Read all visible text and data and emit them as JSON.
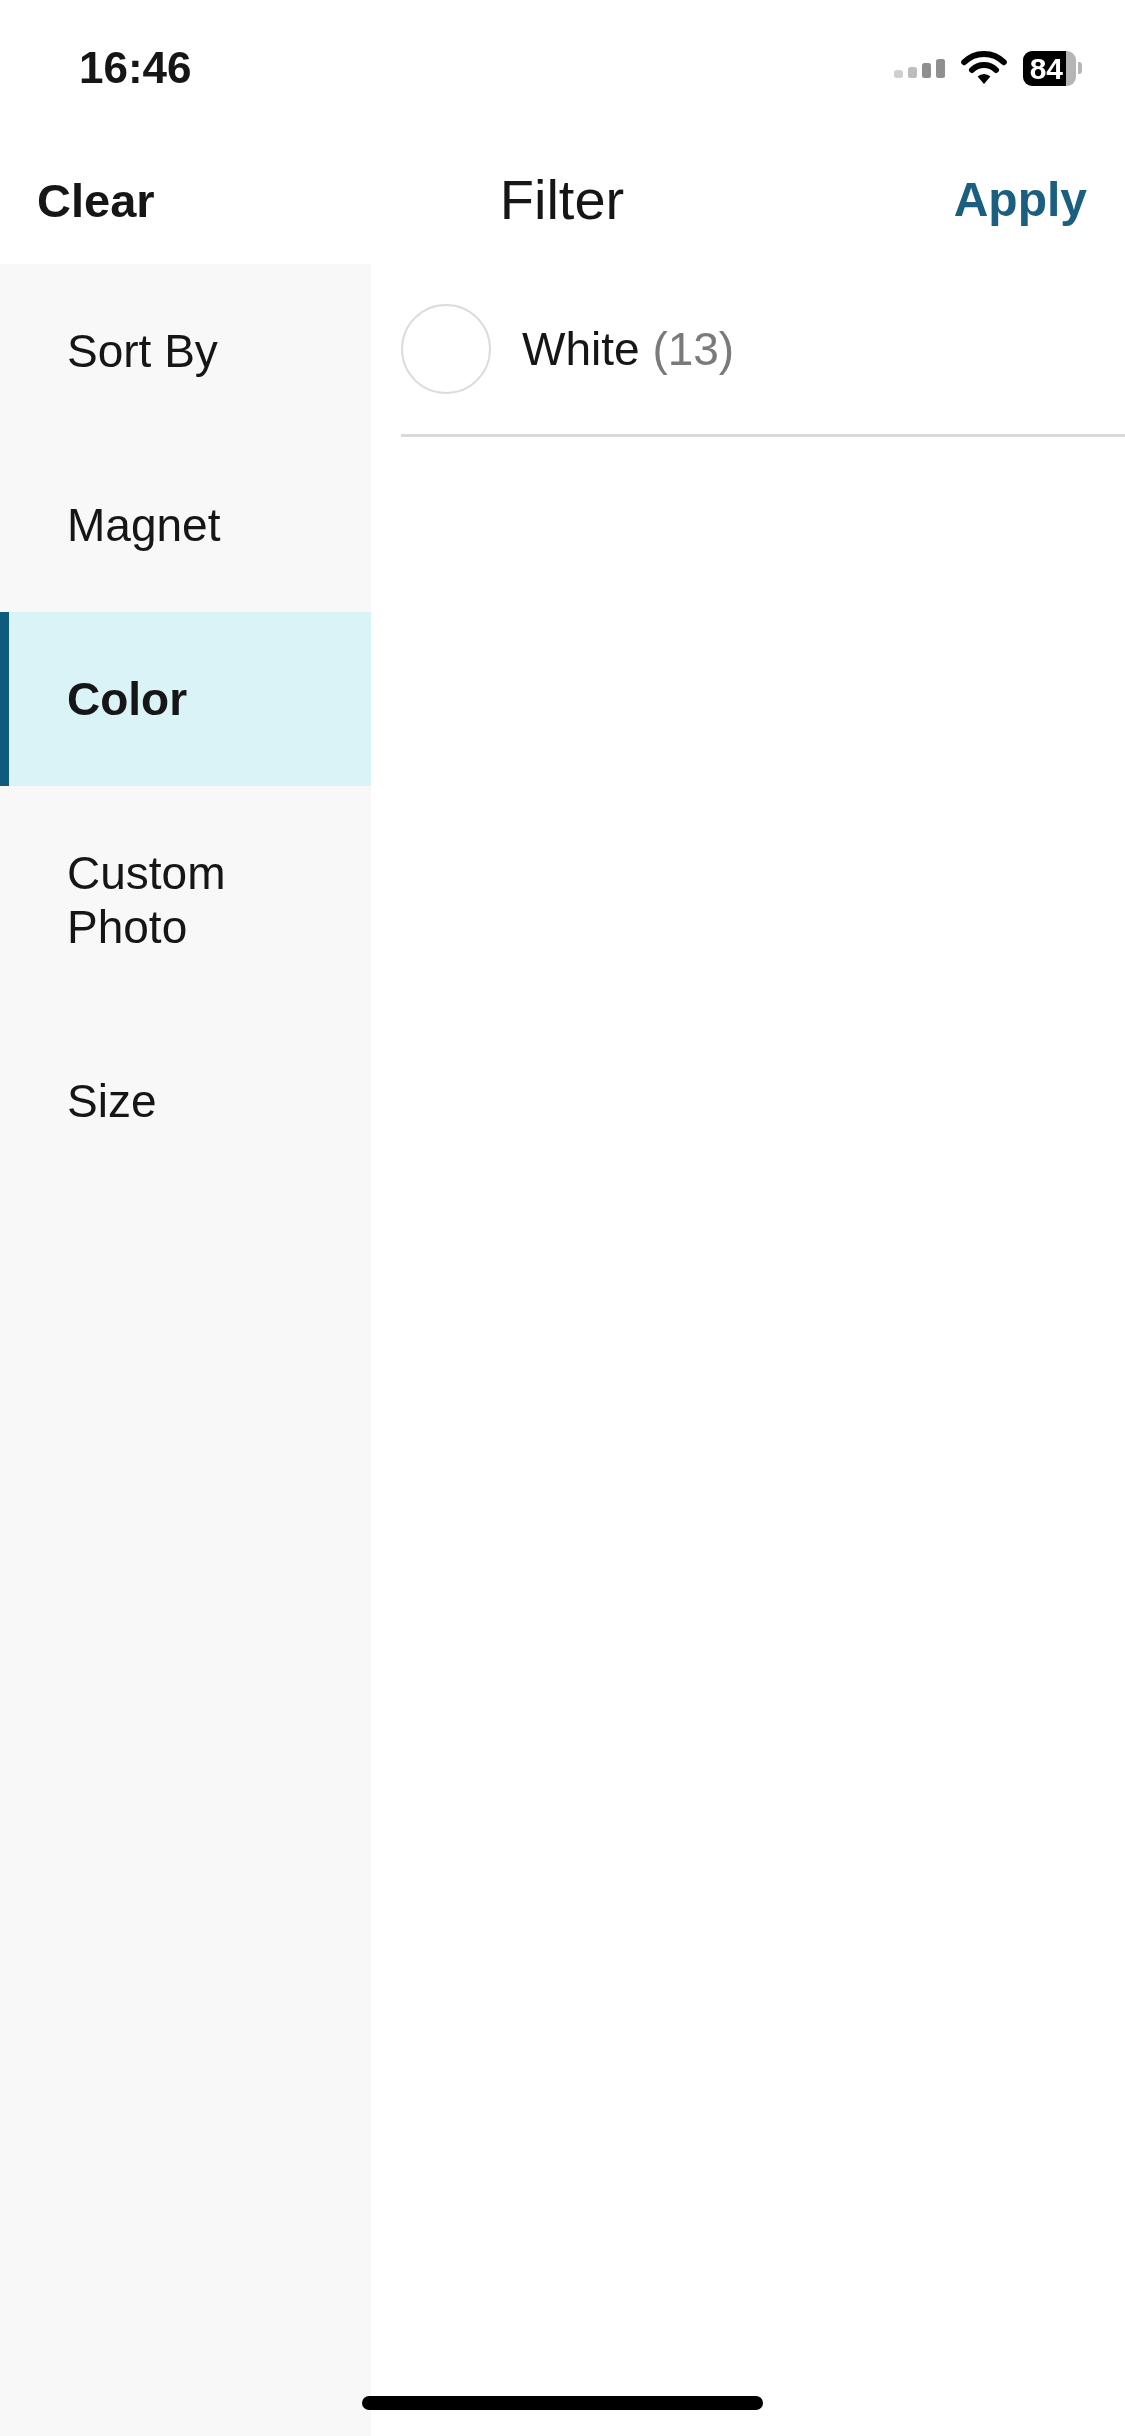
{
  "status_bar": {
    "time": "16:46",
    "battery": "84"
  },
  "header": {
    "left_action": "Clear",
    "title": "Filter",
    "right_action": "Apply"
  },
  "sidebar": {
    "items": [
      {
        "label": "Sort By",
        "selected": false
      },
      {
        "label": "Magnet",
        "selected": false
      },
      {
        "label": "Color",
        "selected": true
      },
      {
        "label": "Custom Photo",
        "selected": false
      },
      {
        "label": "Size",
        "selected": false
      }
    ]
  },
  "options": [
    {
      "label": "White",
      "count": "(13)",
      "color": "#ffffff"
    }
  ]
}
